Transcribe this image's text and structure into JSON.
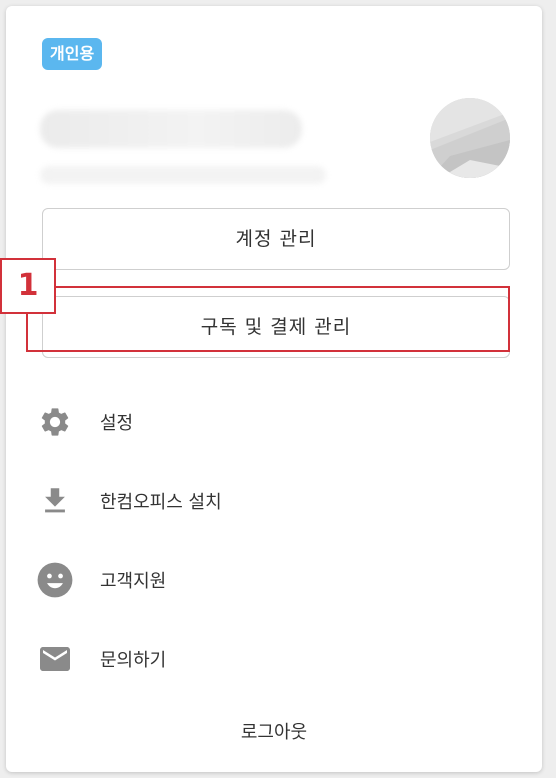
{
  "account": {
    "badge": "개인용"
  },
  "buttons": {
    "manage_account": "계정 관리",
    "manage_subscription": "구독 및 결제 관리"
  },
  "annotation": {
    "marker": "1",
    "color": "#d2313a"
  },
  "menu": [
    {
      "label": "설정",
      "icon": "gear-icon"
    },
    {
      "label": "한컴오피스 설치",
      "icon": "download-icon"
    },
    {
      "label": "고객지원",
      "icon": "smiley-icon"
    },
    {
      "label": "문의하기",
      "icon": "mail-icon"
    }
  ],
  "logout": "로그아웃",
  "colors": {
    "badge": "#5bb7ef",
    "icon": "#8a8a8a",
    "text": "#333333"
  }
}
